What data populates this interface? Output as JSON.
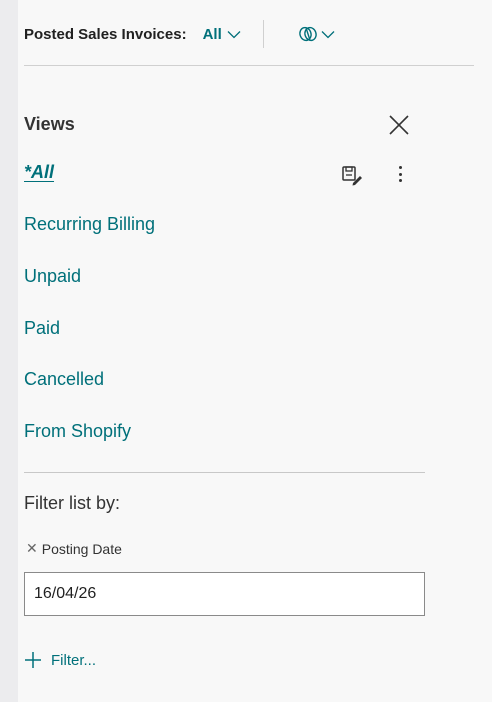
{
  "header": {
    "title": "Posted Sales Invoices:",
    "view_selector_label": "All",
    "copilot_icon": "copilot-icon"
  },
  "views": {
    "title": "Views",
    "close_icon": "close-icon",
    "items": [
      {
        "label": "*All",
        "active": true
      },
      {
        "label": "Recurring Billing"
      },
      {
        "label": "Unpaid"
      },
      {
        "label": "Paid"
      },
      {
        "label": "Cancelled"
      },
      {
        "label": "From Shopify"
      }
    ],
    "save_icon": "save-view-icon",
    "more_icon": "more-options-icon"
  },
  "filters": {
    "heading": "Filter list by:",
    "active_filter_label": "Posting Date",
    "active_filter_value": "16/04/26",
    "add_filter_label": "Filter..."
  },
  "colors": {
    "accent": "#00707a",
    "text": "#212121",
    "background": "#f8f8f8"
  }
}
